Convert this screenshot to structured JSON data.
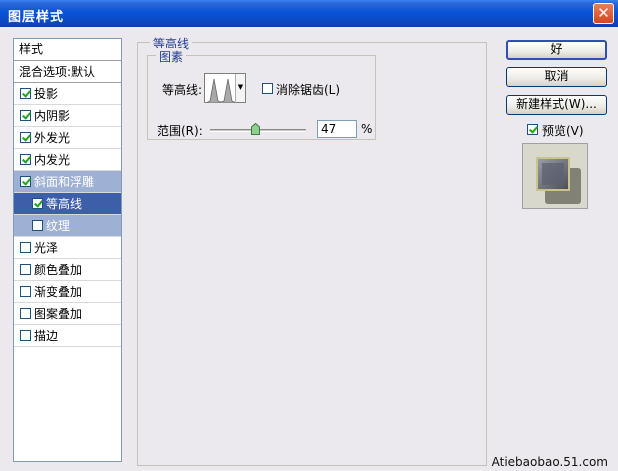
{
  "window": {
    "title": "图层样式",
    "close_glyph": "✕"
  },
  "sidebar": {
    "header": "样式",
    "blend_options": "混合选项:默认",
    "items": [
      {
        "label": "投影",
        "checked": true
      },
      {
        "label": "内阴影",
        "checked": true
      },
      {
        "label": "外发光",
        "checked": true
      },
      {
        "label": "内发光",
        "checked": true
      },
      {
        "label": "斜面和浮雕",
        "checked": true
      },
      {
        "label": "等高线",
        "checked": true
      },
      {
        "label": "纹理",
        "checked": false
      },
      {
        "label": "光泽",
        "checked": false
      },
      {
        "label": "颜色叠加",
        "checked": false
      },
      {
        "label": "渐变叠加",
        "checked": false
      },
      {
        "label": "图案叠加",
        "checked": false
      },
      {
        "label": "描边",
        "checked": false
      }
    ]
  },
  "panel": {
    "group_title": "等高线",
    "subgroup_title": "图素",
    "contour_label": "等高线:",
    "antialias_label": "消除锯齿(L)",
    "antialias_checked": false,
    "range_label": "范围(R):",
    "range_value": "47",
    "range_unit": "%",
    "range_fraction": 0.47
  },
  "buttons": {
    "ok": "好",
    "cancel": "取消",
    "new_style": "新建样式(W)...",
    "preview_label": "预览(V)",
    "preview_checked": true
  },
  "watermark": "Atiebaobao.51.com",
  "icons": {
    "close": "close-icon",
    "contour_dropdown": "chevron-down-icon",
    "slider": "slider-thumb-icon"
  },
  "colors": {
    "titlebar": "#0a54d6",
    "selection": "#3d5ea8",
    "selection_light": "#9eb0d3",
    "group_title": "#1f3b95"
  }
}
